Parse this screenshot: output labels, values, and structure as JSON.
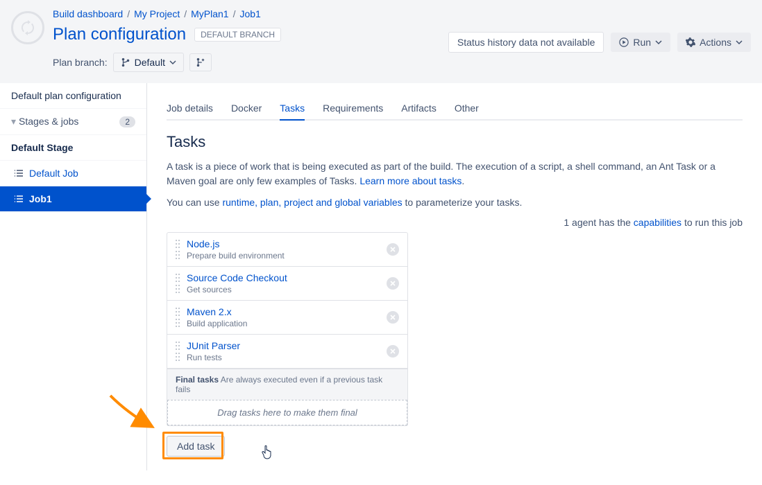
{
  "breadcrumb": {
    "item0": "Build dashboard",
    "item1": "My Project",
    "item2": "MyPlan1",
    "item3": "Job1"
  },
  "header": {
    "title": "Plan configuration",
    "branch_badge": "DEFAULT BRANCH",
    "plan_branch_label": "Plan branch:",
    "branch_select_value": "Default"
  },
  "header_actions": {
    "status": "Status history data not available",
    "run": "Run",
    "actions": "Actions"
  },
  "sidebar": {
    "default_plan_config": "Default plan configuration",
    "stages_jobs": "Stages & jobs",
    "stages_count": "2",
    "stage_name": "Default Stage",
    "job0": "Default Job",
    "job1": "Job1"
  },
  "tabs": {
    "t0": "Job details",
    "t1": "Docker",
    "t2": "Tasks",
    "t3": "Requirements",
    "t4": "Artifacts",
    "t5": "Other"
  },
  "content": {
    "section_title": "Tasks",
    "desc1a": "A task is a piece of work that is being executed as part of the build. The execution of a script, a shell command, an Ant Task or a Maven goal are only few examples of Tasks. ",
    "desc1_link": "Learn more about tasks",
    "desc2a": "You can use ",
    "desc2_link": "runtime, plan, project and global variables",
    "desc2b": " to parameterize your tasks.",
    "agent_a": "1 agent has the ",
    "agent_link": "capabilities",
    "agent_b": " to run this job"
  },
  "tasks": {
    "t0": {
      "title": "Node.js",
      "sub": "Prepare build environment"
    },
    "t1": {
      "title": "Source Code Checkout",
      "sub": "Get sources"
    },
    "t2": {
      "title": "Maven 2.x",
      "sub": "Build application"
    },
    "t3": {
      "title": "JUnit Parser",
      "sub": "Run tests"
    }
  },
  "final": {
    "label": "Final tasks",
    "desc": "Are always executed even if a previous task fails",
    "drop_hint": "Drag tasks here to make them final"
  },
  "add_task": "Add task"
}
